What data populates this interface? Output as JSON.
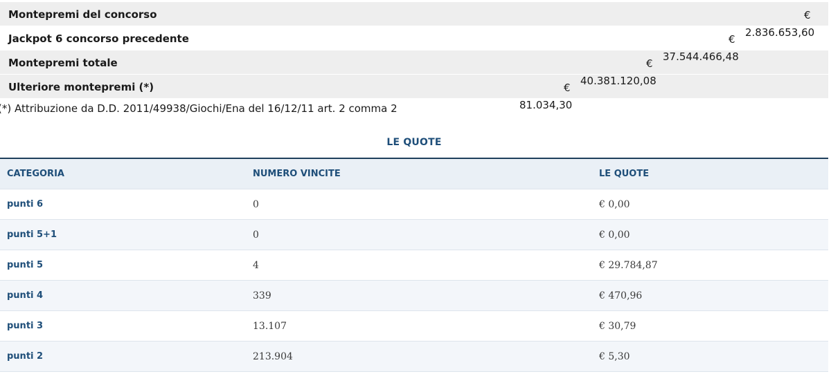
{
  "prize_rows": [
    {
      "label": "Montepremi del concorso",
      "euro": "€",
      "amount": ""
    },
    {
      "label": "Jackpot 6 concorso precedente",
      "euro": "€",
      "amount": "2.836.653,60"
    },
    {
      "label": "Montepremi totale",
      "euro": "€",
      "amount": "37.544.466,48"
    },
    {
      "label": "Ulteriore montepremi (*)",
      "euro": "€",
      "amount": "40.381.120,08"
    }
  ],
  "overflow_amount": "81.034,30",
  "footnote": "(*) Attribuzione da D.D. 2011/49938/Giochi/Ena del 16/12/11 art. 2 comma 2",
  "quote_table": {
    "title": "LE QUOTE",
    "headers": [
      "CATEGORIA",
      "NUMERO VINCITE",
      "LE QUOTE"
    ],
    "rows": [
      {
        "categoria": "punti 6",
        "vincite": "0",
        "quota": "€ 0,00"
      },
      {
        "categoria": "punti 5+1",
        "vincite": "0",
        "quota": "€ 0,00"
      },
      {
        "categoria": "punti 5",
        "vincite": "4",
        "quota": "€ 29.784,87"
      },
      {
        "categoria": "punti 4",
        "vincite": "339",
        "quota": "€ 470,96"
      },
      {
        "categoria": "punti 3",
        "vincite": "13.107",
        "quota": "€ 30,79"
      },
      {
        "categoria": "punti 2",
        "vincite": "213.904",
        "quota": "€ 5,30"
      }
    ]
  }
}
